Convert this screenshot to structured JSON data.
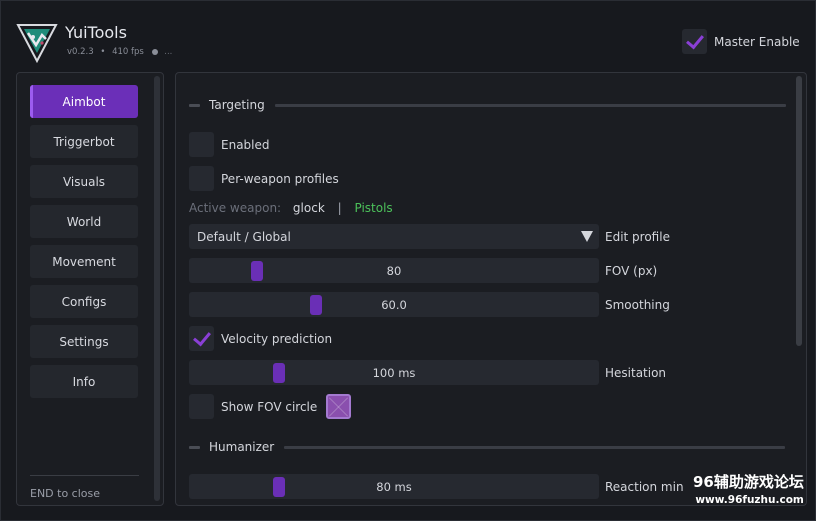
{
  "app": {
    "title": "YuiTools",
    "version": "v0.2.3",
    "sep": "•",
    "fps": "410 fps",
    "status_extra": "..."
  },
  "master": {
    "label": "Master Enable",
    "checked": true
  },
  "sidebar": {
    "items": [
      {
        "label": "Aimbot",
        "active": true
      },
      {
        "label": "Triggerbot"
      },
      {
        "label": "Visuals"
      },
      {
        "label": "World"
      },
      {
        "label": "Movement"
      },
      {
        "label": "Configs"
      },
      {
        "label": "Settings"
      },
      {
        "label": "Info"
      }
    ],
    "hint": "END to close"
  },
  "targeting": {
    "title": "Targeting",
    "enabled": {
      "label": "Enabled",
      "checked": false
    },
    "per_weapon": {
      "label": "Per-weapon profiles",
      "checked": false
    },
    "active_weapon_label": "Active weapon:",
    "active_weapon_value": "glock",
    "active_weapon_sep": "|",
    "active_weapon_class": "Pistols",
    "profile_select": "Default / Global",
    "profile_label": "Edit profile",
    "fov": {
      "value": "80",
      "label": "FOV (px)",
      "fraction": 0.155
    },
    "smoothing": {
      "value": "60.0",
      "label": "Smoothing",
      "fraction": 0.305
    },
    "velocity": {
      "label": "Velocity prediction",
      "checked": true
    },
    "hesitation": {
      "value": "100 ms",
      "label": "Hesitation",
      "fraction": 0.21
    },
    "show_fov": {
      "label": "Show FOV circle",
      "checked": false
    }
  },
  "humanizer": {
    "title": "Humanizer",
    "reaction_min": {
      "value": "80 ms",
      "label": "Reaction min",
      "fraction": 0.21
    }
  },
  "watermark": {
    "line1": "96辅助游戏论坛",
    "line2": "www.96fuzhu.com"
  },
  "colors": {
    "accent": "#6b2fb8",
    "check": "#8a3fd6",
    "weapon_class": "#4cc15a"
  }
}
